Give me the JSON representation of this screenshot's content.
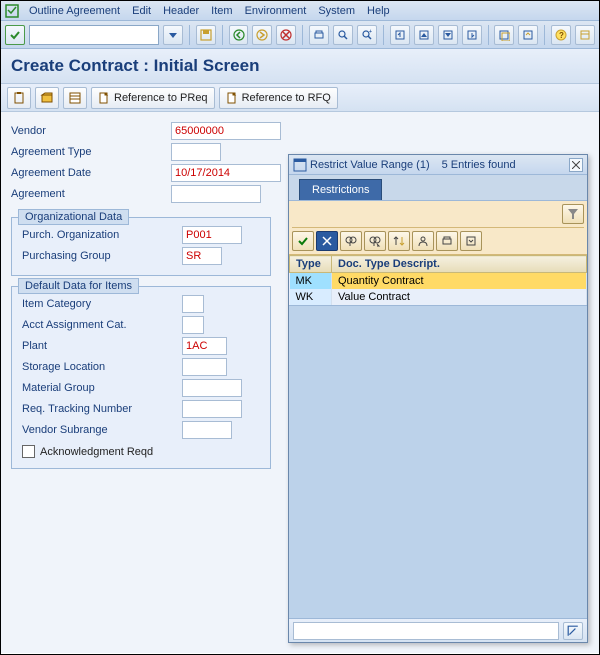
{
  "menu": {
    "items": [
      "Outline Agreement",
      "Edit",
      "Header",
      "Item",
      "Environment",
      "System",
      "Help"
    ]
  },
  "title": "Create Contract : Initial Screen",
  "apptoolbar": {
    "ref_preq": "Reference to PReq",
    "ref_rfq": "Reference to RFQ"
  },
  "header_fields": {
    "vendor": {
      "label": "Vendor",
      "value": "65000000"
    },
    "agreement_type": {
      "label": "Agreement Type",
      "value": ""
    },
    "agreement_date": {
      "label": "Agreement Date",
      "value": "10/17/2014"
    },
    "agreement": {
      "label": "Agreement",
      "value": ""
    }
  },
  "org": {
    "title": "Organizational Data",
    "purch_org": {
      "label": "Purch. Organization",
      "value": "P001"
    },
    "purch_group": {
      "label": "Purchasing Group",
      "value": "SR"
    }
  },
  "defaults": {
    "title": "Default Data for Items",
    "item_category": {
      "label": "Item Category",
      "value": ""
    },
    "acct_assign": {
      "label": "Acct Assignment Cat.",
      "value": ""
    },
    "plant": {
      "label": "Plant",
      "value": "1AC"
    },
    "storage_loc": {
      "label": "Storage Location",
      "value": ""
    },
    "material_group": {
      "label": "Material Group",
      "value": ""
    },
    "req_tracking": {
      "label": "Req. Tracking Number",
      "value": ""
    },
    "vendor_subrange": {
      "label": "Vendor Subrange",
      "value": ""
    },
    "ack_reqd": {
      "label": "Acknowledgment Reqd"
    }
  },
  "popup": {
    "title_left": "Restrict Value Range (1)",
    "title_right": "5 Entries found",
    "tab": "Restrictions",
    "cols": {
      "type": "Type",
      "desc": "Doc. Type Descript."
    },
    "rows": [
      {
        "type": "MK",
        "desc": "Quantity Contract"
      },
      {
        "type": "WK",
        "desc": "Value Contract"
      }
    ]
  }
}
